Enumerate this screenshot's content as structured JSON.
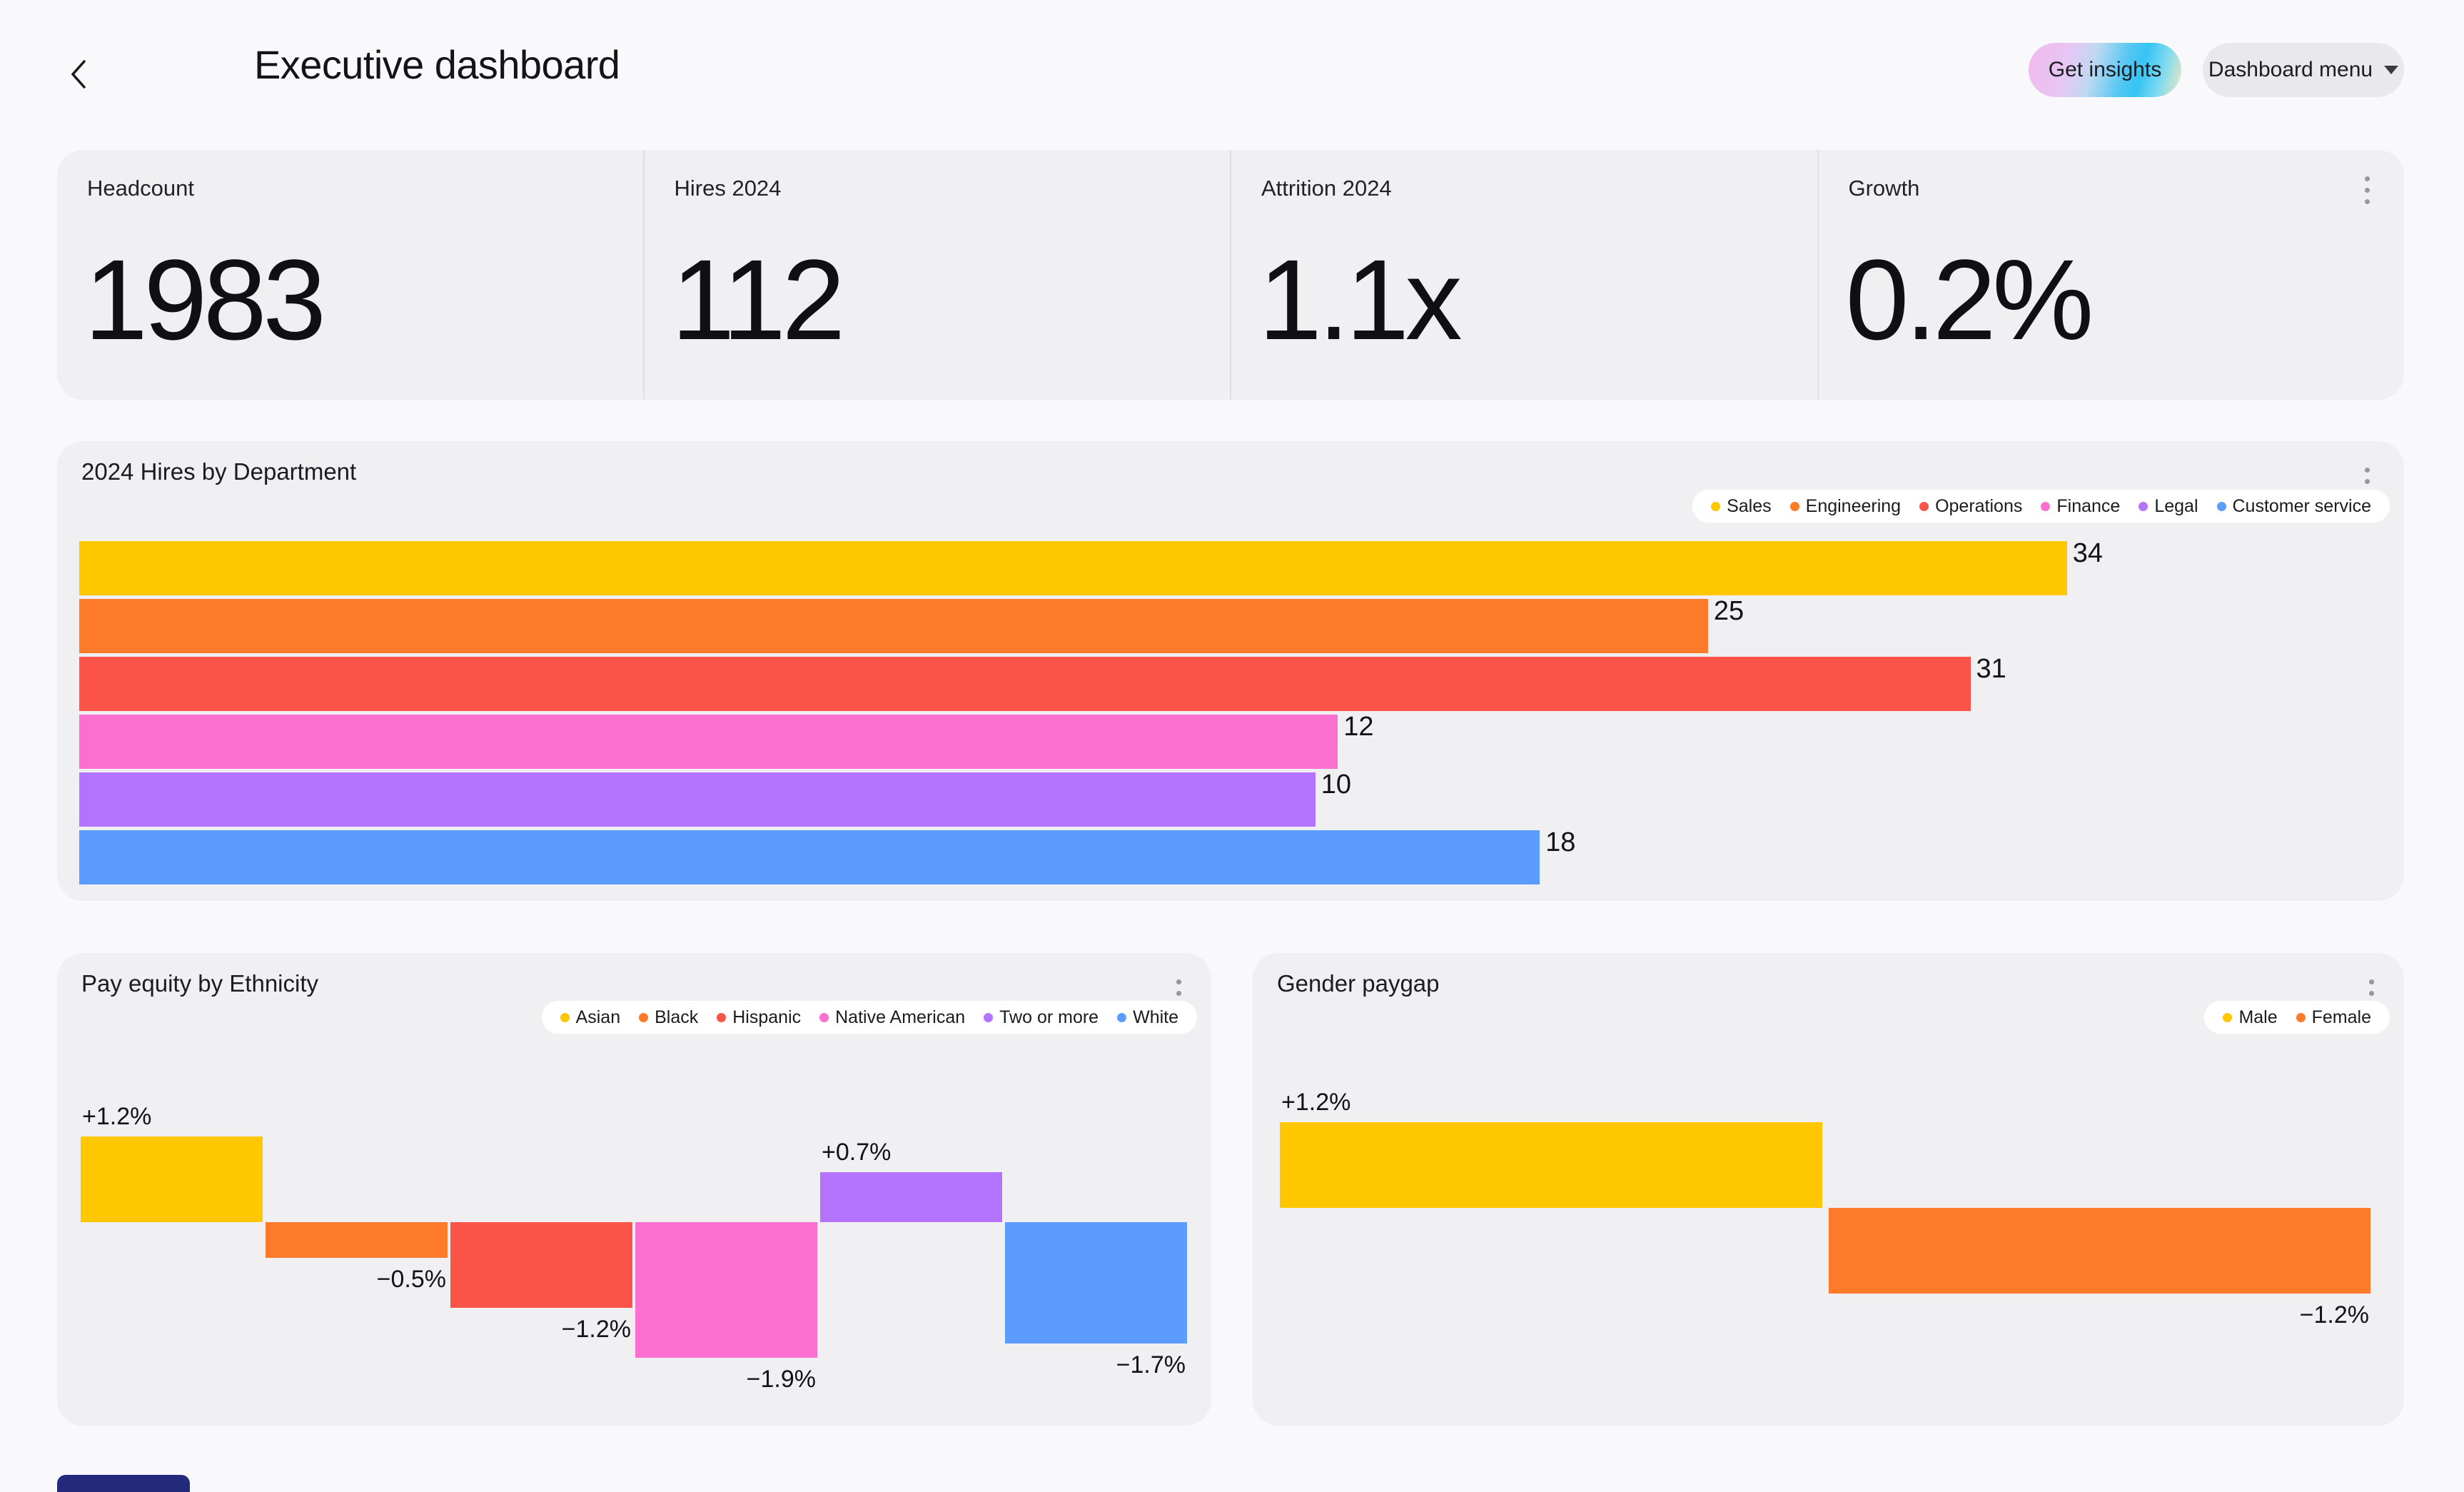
{
  "header": {
    "title": "Executive dashboard",
    "back_icon": "chevron-left",
    "buttons": {
      "get_insights": "Get insights",
      "dashboard_menu": "Dashboard menu",
      "dashboard_menu_caret": "caret-down"
    }
  },
  "kpi_card": {
    "menu_icon": "kebab-vertical",
    "items": [
      {
        "label": "Headcount",
        "value": "1983"
      },
      {
        "label": "Hires 2024",
        "value": "112"
      },
      {
        "label": "Attrition 2024",
        "value": "1.1x"
      },
      {
        "label": "Growth",
        "value": "0.2%"
      }
    ]
  },
  "colors": {
    "page_bg": "#F9F9FB",
    "card_bg": "#F0F0F3",
    "text": "#18181C",
    "divider": "#DEDEE3",
    "legend_bg": "#FFFFFF",
    "kebab_dots": "#97979C",
    "series": {
      "yellow": "#FFC700",
      "orange": "#FE7A2B",
      "red": "#FC5348",
      "pink": "#FB6FD0",
      "purple": "#B473FC",
      "blue": "#5C9CFE"
    },
    "bottom_partial": "#232A7C",
    "get_insights_gradient": [
      "#F2B9EE",
      "#E7C6F4",
      "#BFD9F2",
      "#52C7F2",
      "#7EDAF0",
      "#F0E8C0"
    ]
  },
  "chart_data": [
    {
      "type": "bar",
      "orientation": "horizontal",
      "title": "2024 Hires by Department",
      "menu_icon": "kebab-vertical",
      "legend_position": "top-right",
      "categories": [
        "Sales",
        "Engineering",
        "Operations",
        "Finance",
        "Legal",
        "Customer service"
      ],
      "values": [
        34,
        25,
        31,
        12,
        10,
        18
      ],
      "value_labels": [
        "34",
        "25",
        "31",
        "12",
        "10",
        "18"
      ],
      "colors": [
        "#FFC700",
        "#FE7A2B",
        "#FC5348",
        "#FB6FD0",
        "#B473FC",
        "#5C9CFE"
      ],
      "bar_length_pct": [
        88.6,
        72.6,
        84.3,
        56.1,
        55.1,
        65.1
      ],
      "grid": false,
      "axes_labels_visible": false
    },
    {
      "type": "bar",
      "orientation": "vertical-diverging",
      "title": "Pay equity by Ethnicity",
      "menu_icon": "kebab-vertical",
      "legend_position": "top-right",
      "unit": "%",
      "baseline": 0,
      "categories": [
        "Asian",
        "Black",
        "Hispanic",
        "Native American",
        "Two or more",
        "White"
      ],
      "values": [
        1.2,
        -0.5,
        -1.2,
        -1.9,
        0.7,
        -1.7
      ],
      "value_labels": [
        "+1.2%",
        "−0.5%",
        "−1.2%",
        "−1.9%",
        "+0.7%",
        "−1.7%"
      ],
      "colors": [
        "#FFC700",
        "#FE7A2B",
        "#FC5348",
        "#FB6FD0",
        "#B473FC",
        "#5C9CFE"
      ],
      "grid": false,
      "axes_labels_visible": false
    },
    {
      "type": "bar",
      "orientation": "vertical-diverging",
      "title": "Gender paygap",
      "menu_icon": "kebab-vertical",
      "legend_position": "top-right",
      "unit": "%",
      "baseline": 0,
      "categories": [
        "Male",
        "Female"
      ],
      "values": [
        1.2,
        -1.2
      ],
      "value_labels": [
        "+1.2%",
        "−1.2%"
      ],
      "colors": [
        "#FFC700",
        "#FE7A2B"
      ],
      "grid": false,
      "axes_labels_visible": false
    }
  ]
}
